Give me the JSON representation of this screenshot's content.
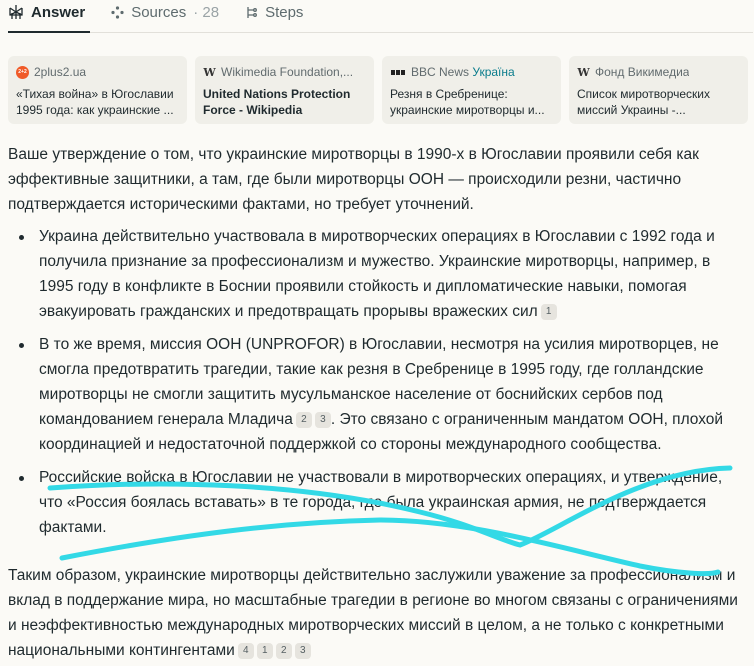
{
  "tabs": [
    {
      "label": "Answer",
      "active": true
    },
    {
      "label": "Sources",
      "count": "· 28"
    },
    {
      "label": "Steps"
    }
  ],
  "sources": [
    {
      "site": "2plus2.ua",
      "icon": "2plus2-logo-icon",
      "favicon_text": "2+2",
      "title": "«Тихая война» в Югославии 1995 года: как украинские ..."
    },
    {
      "site": "Wikimedia Foundation,...",
      "icon": "wikipedia-icon",
      "favicon_text": "W",
      "title": "United Nations Protection Force - Wikipedia"
    },
    {
      "site": "BBC News",
      "site_suffix": "Україна",
      "icon": "bbc-logo-icon",
      "title": "Резня в Сребренице: украинские миротворцы и..."
    },
    {
      "site": "Фонд Викимедиа",
      "icon": "wikipedia-icon",
      "favicon_text": "W",
      "title": "Список миротворческих миссий Украины -..."
    }
  ],
  "answer": {
    "intro": "Ваше утверждение о том, что украинские миротворцы в 1990-х в Югославии проявили себя как эффективные защитники, а там, где были миротворцы ООН — происходили резни, частично подтверждается историческими фактами, но требует уточнений.",
    "bullets": [
      {
        "text": "Украина действительно участвовала в миротворческих операциях в Югославии с 1992 года и получила признание за профессионализм и мужество. Украинские миротворцы, например, в 1995 году в конфликте в Боснии проявили стойкость и дипломатические навыки, помогая эвакуировать гражданских и предотвращать прорывы вражеских сил",
        "cites": [
          "1"
        ],
        "tail": ""
      },
      {
        "text": "В то же время, миссия ООН (UNPROFOR) в Югославии, несмотря на усилия миротворцев, не смогла предотвратить трагедии, такие как резня в Сребренице в 1995 году, где голландские миротворцы не смогли защитить мусульманское население от боснийских сербов под командованием генерала Младича",
        "cites": [
          "2",
          "3"
        ],
        "tail": ". Это связано с ограниченным мандатом ООН, плохой координацией и недостаточной поддержкой со стороны международного сообщества."
      },
      {
        "text": "Российские войска в Югославии не участвовали в миротворческих операциях, и утверждение, что «Россия боялась вставать» в те города, где была украинская армия, не подтверждается фактами.",
        "cites": [],
        "tail": ""
      }
    ],
    "conclusion": "Таким образом, украинские миротворцы действительно заслужили уважение за профессионализм и вклад в поддержание мира, но масштабные трагедии в регионе во многом связаны с ограничениями и неэффективностью международных миротворческих миссий в целом, а не только с конкретными национальными контингентами",
    "conclusion_cites": [
      "4",
      "1",
      "2",
      "3"
    ]
  },
  "colors": {
    "scribble": "#33d9e6",
    "background": "#fbfaf6",
    "text": "#1f2a2e"
  }
}
